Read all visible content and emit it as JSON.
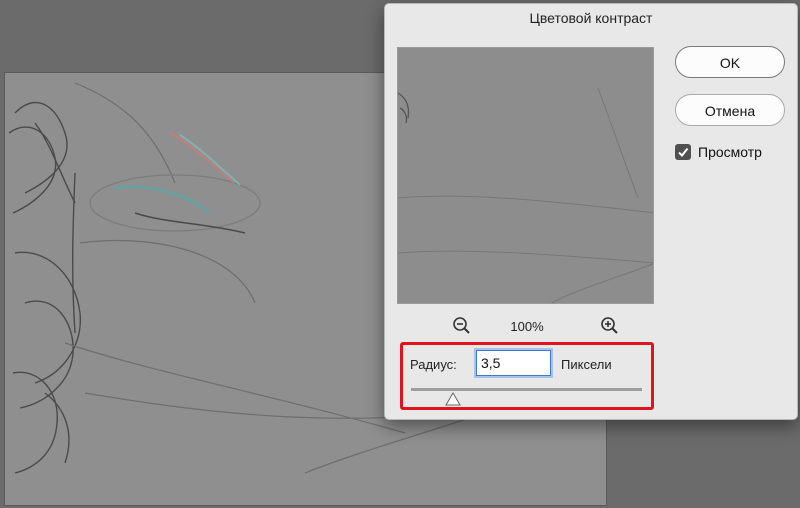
{
  "dialog": {
    "title": "Цветовой контраст",
    "ok_label": "OK",
    "cancel_label": "Отмена",
    "preview_label": "Просмотр",
    "preview_checked": true,
    "zoom_level": "100%",
    "radius": {
      "label": "Радиус:",
      "value": "3,5",
      "units": "Пиксели",
      "slider_fraction": 0.18
    }
  },
  "icons": {
    "zoom_out": "zoom-out-magnifier",
    "zoom_in": "zoom-in-magnifier",
    "checkmark": "checkmark",
    "slider_thumb": "triangle-thumb",
    "arrow": "red-arrow-right"
  },
  "colors": {
    "highlight": "#e0141b",
    "arrow": "#e0141b",
    "canvas_gray": "#8f8f8f"
  }
}
